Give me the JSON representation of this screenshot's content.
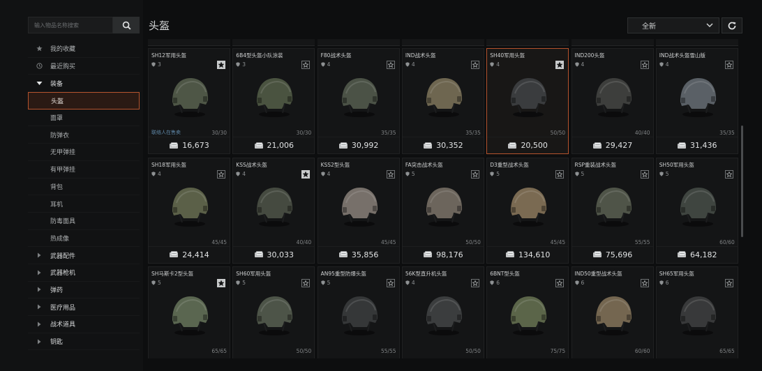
{
  "search": {
    "placeholder": "输入物品名称搜索"
  },
  "header": {
    "title": "头盔",
    "sort": "全新"
  },
  "sidebar": {
    "items": [
      {
        "label": "我的收藏",
        "icon": "star-icon",
        "kind": "top"
      },
      {
        "label": "最近购买",
        "icon": "clock-icon",
        "kind": "top"
      },
      {
        "label": "装备",
        "icon": "caret-down-icon",
        "kind": "parent"
      },
      {
        "label": "头盔",
        "kind": "sub",
        "active": true
      },
      {
        "label": "面罩",
        "kind": "sub"
      },
      {
        "label": "防弹衣",
        "kind": "sub"
      },
      {
        "label": "无甲弹挂",
        "kind": "sub"
      },
      {
        "label": "有甲弹挂",
        "kind": "sub"
      },
      {
        "label": "背包",
        "kind": "sub"
      },
      {
        "label": "耳机",
        "kind": "sub"
      },
      {
        "label": "防毒面具",
        "kind": "sub"
      },
      {
        "label": "热成像",
        "kind": "sub"
      },
      {
        "label": "武器配件",
        "icon": "caret-right-icon",
        "kind": "parent"
      },
      {
        "label": "武器枪机",
        "icon": "caret-right-icon",
        "kind": "parent"
      },
      {
        "label": "弹药",
        "icon": "caret-right-icon",
        "kind": "parent"
      },
      {
        "label": "医疗用品",
        "icon": "caret-right-icon",
        "kind": "parent"
      },
      {
        "label": "战术道具",
        "icon": "caret-right-icon",
        "kind": "parent"
      },
      {
        "label": "钥匙",
        "icon": "caret-right-icon",
        "kind": "parent"
      }
    ]
  },
  "items": [
    {
      "name": "SH12军用头盔",
      "rarity": "3",
      "fav": true,
      "stock": "30/30",
      "price": "16,673",
      "seller": "联络人在售卖",
      "color": "#4e5646"
    },
    {
      "name": "6B4型头盔小队涂装",
      "rarity": "3",
      "fav": false,
      "stock": "30/30",
      "price": "21,006",
      "color": "#4a5340"
    },
    {
      "name": "F80战术头盔",
      "rarity": "4",
      "fav": false,
      "stock": "35/35",
      "price": "30,992",
      "color": "#4b5246"
    },
    {
      "name": "IND战术头盔",
      "rarity": "4",
      "fav": false,
      "stock": "35/35",
      "price": "30,352",
      "color": "#6e6650"
    },
    {
      "name": "SH40军用头盔",
      "rarity": "4",
      "fav": true,
      "stock": "50/50",
      "price": "20,500",
      "selected": true,
      "color": "#3a3c3e"
    },
    {
      "name": "IND200头盔",
      "rarity": "4",
      "fav": false,
      "stock": "40/40",
      "price": "29,427",
      "color": "#3d3e3c"
    },
    {
      "name": "IND战术头盔雪山版",
      "rarity": "4",
      "fav": false,
      "stock": "35/35",
      "price": "31,436",
      "color": "#5a6066"
    },
    {
      "name": "SH18军用头盔",
      "rarity": "4",
      "fav": false,
      "stock": "45/45",
      "price": "24,414",
      "color": "#5b6048"
    },
    {
      "name": "KSS战术头盔",
      "rarity": "4",
      "fav": true,
      "stock": "40/40",
      "price": "30,033",
      "color": "#454a40"
    },
    {
      "name": "KSS2型头盔",
      "rarity": "4",
      "fav": false,
      "stock": "45/45",
      "price": "35,856",
      "color": "#77706a"
    },
    {
      "name": "FA突击战术头盔",
      "rarity": "5",
      "fav": false,
      "stock": "50/50",
      "price": "98,176",
      "color": "#6c655c"
    },
    {
      "name": "D3重型战术头盔",
      "rarity": "5",
      "fav": false,
      "stock": "45/45",
      "price": "134,610",
      "color": "#7a6a52"
    },
    {
      "name": "RSP重装战术头盔",
      "rarity": "5",
      "fav": false,
      "stock": "55/55",
      "price": "75,696",
      "color": "#4f5448"
    },
    {
      "name": "SH50军用头盔",
      "rarity": "5",
      "fav": false,
      "stock": "60/60",
      "price": "64,182",
      "color": "#3f4540"
    },
    {
      "name": "SH马斯卡2型头盔",
      "rarity": "5",
      "fav": true,
      "stock": "65/65",
      "price": "",
      "color": "#5a6650"
    },
    {
      "name": "SH60军用头盔",
      "rarity": "5",
      "fav": false,
      "stock": "50/50",
      "price": "",
      "color": "#4d5448"
    },
    {
      "name": "AN95重型防爆头盔",
      "rarity": "5",
      "fav": false,
      "stock": "55/55",
      "price": "",
      "color": "#353738"
    },
    {
      "name": "56K型直升机头盔",
      "rarity": "4",
      "fav": false,
      "stock": "50/50",
      "price": "",
      "color": "#3b3d3e"
    },
    {
      "name": "6BNT型头盔",
      "rarity": "6",
      "fav": false,
      "stock": "75/75",
      "price": "",
      "color": "#5b6549"
    },
    {
      "name": "IND50重型战术头盔",
      "rarity": "6",
      "fav": false,
      "stock": "60/60",
      "price": "",
      "color": "#746650"
    },
    {
      "name": "SH65军用头盔",
      "rarity": "6",
      "fav": false,
      "stock": "65/65",
      "price": "",
      "color": "#38393a"
    }
  ]
}
